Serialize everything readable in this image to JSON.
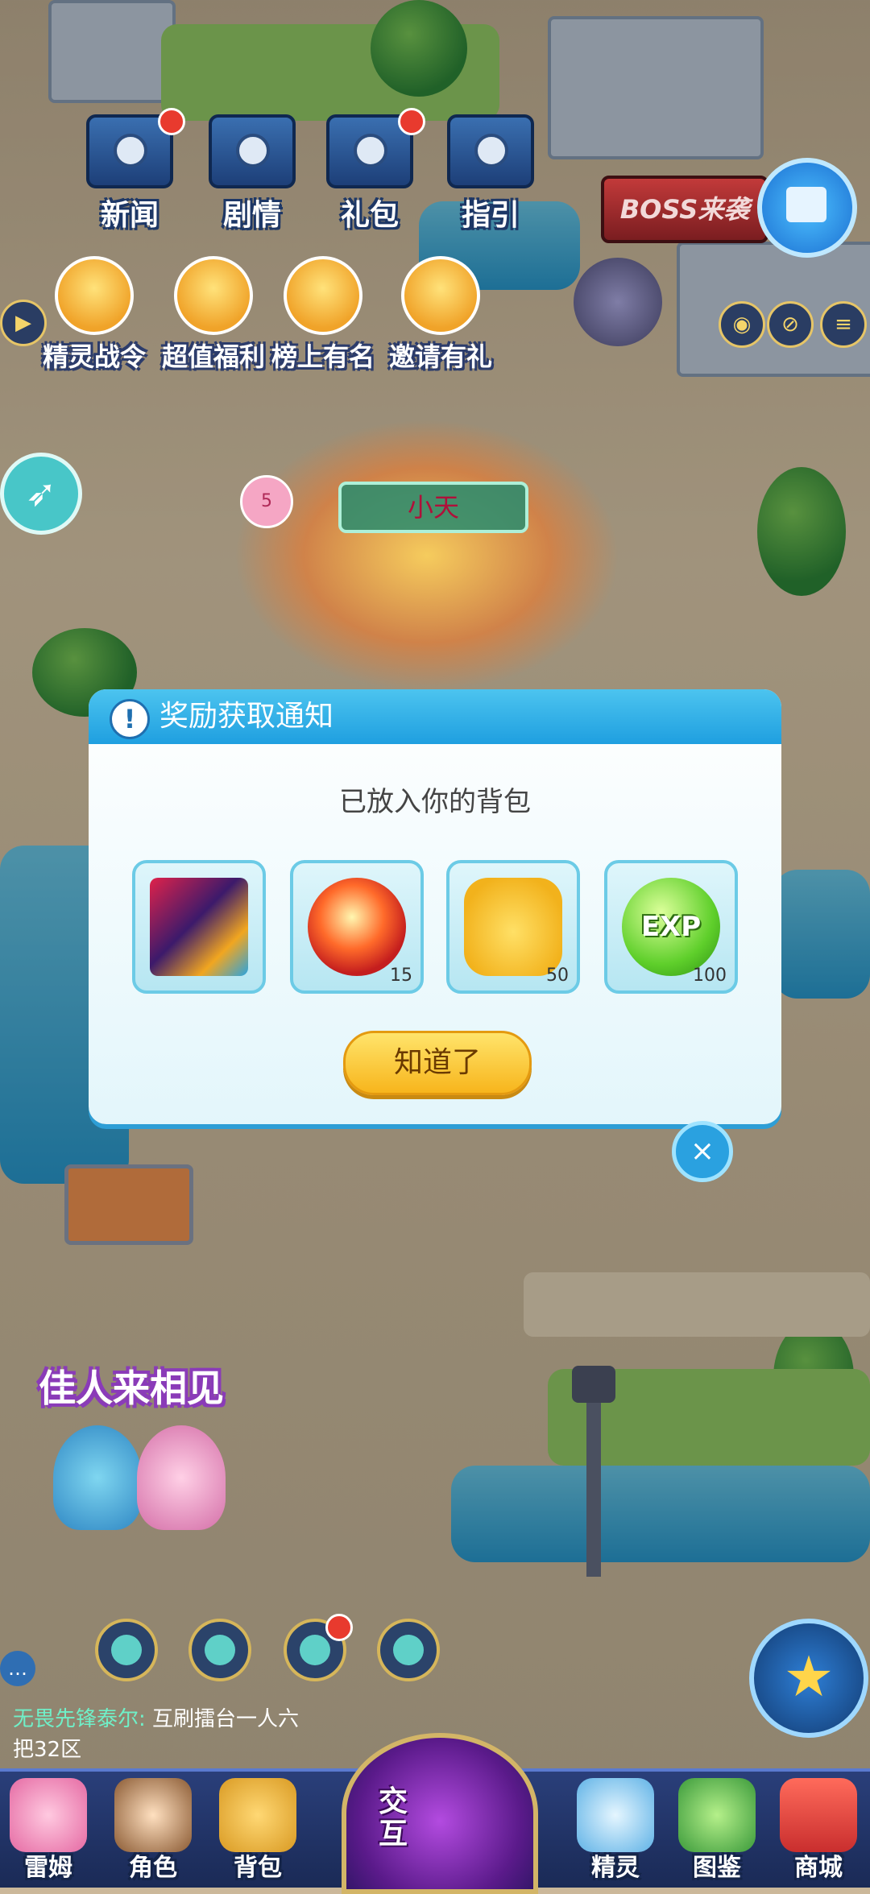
{
  "top_menu": [
    {
      "label": "新闻",
      "icon": "newspaper-icon",
      "badge": true
    },
    {
      "label": "剧情",
      "icon": "story-box-icon",
      "badge": false
    },
    {
      "label": "礼包",
      "icon": "gift-pack-icon",
      "badge": true
    },
    {
      "label": "指引",
      "icon": "guide-box-icon",
      "badge": false
    }
  ],
  "event_menu": [
    {
      "label": "精灵战令",
      "icon": "battle-pass-icon"
    },
    {
      "label": "超值福利",
      "icon": "welfare-gift-icon"
    },
    {
      "label": "榜上有名",
      "icon": "trophy-icon"
    },
    {
      "label": "邀请有礼",
      "icon": "invite-chest-icon"
    }
  ],
  "boss_banner": "BOSS来袭",
  "character": {
    "name": "小天",
    "pet_level": "5"
  },
  "modal": {
    "title": "奖励获取通知",
    "subtitle": "已放入你的背包",
    "items": [
      {
        "icon": "mecha-portrait",
        "qty": ""
      },
      {
        "icon": "fire-orb",
        "qty": "15"
      },
      {
        "icon": "yellow-cat-token",
        "qty": "50"
      },
      {
        "icon": "exp-orb",
        "qty": "100",
        "text": "EXP"
      }
    ],
    "confirm_label": "知道了"
  },
  "scene_banner": "佳人来相见",
  "chat": {
    "speaker": "无畏先锋泰尔:",
    "message_line1": "互刷擂台一人六",
    "message_line2": "把32区"
  },
  "bottom_nav": [
    {
      "label": "雷姆",
      "icon": "lemu-icon"
    },
    {
      "label": "角色",
      "icon": "character-icon"
    },
    {
      "label": "背包",
      "icon": "backpack-icon"
    },
    {
      "label": "交互",
      "icon": "interact-icon"
    },
    {
      "label": "精灵",
      "icon": "spirit-icon"
    },
    {
      "label": "图鉴",
      "icon": "codex-icon"
    },
    {
      "label": "商城",
      "icon": "shop-icon"
    }
  ],
  "colors": {
    "modal_header": "#1f9fe0",
    "confirm_button": "#f7b51c",
    "badge": "#e83a2e"
  }
}
